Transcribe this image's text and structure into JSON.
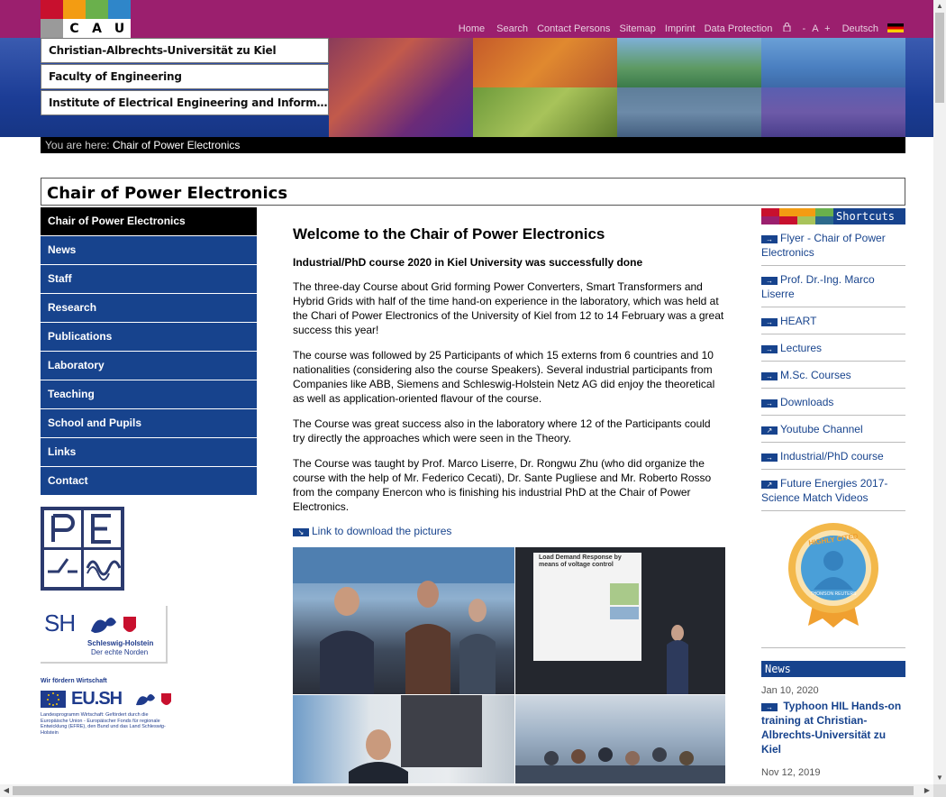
{
  "logo": {
    "letters": [
      "C",
      "A",
      "U"
    ],
    "colors": [
      "#c8102e",
      "#f39c12",
      "#6ab04c",
      "#1f8f8f",
      "#2d3a8c",
      "#888888"
    ]
  },
  "topnav": {
    "items": [
      "Home",
      "Search",
      "Contact Persons",
      "Sitemap",
      "Imprint",
      "Data Protection"
    ],
    "font_minus": "-",
    "font_a": "A",
    "font_plus": "+",
    "language": "Deutsch"
  },
  "header_tabs": [
    "Christian-Albrechts-Universität zu Kiel",
    "Faculty of Engineering",
    "Institute of Electrical Engineering and Information..."
  ],
  "breadcrumb": {
    "prefix": "You are here:",
    "current": "Chair of Power Electronics"
  },
  "page_title": "Chair of Power Electronics",
  "left_nav": [
    "Chair of Power Electronics",
    "News",
    "Staff",
    "Research",
    "Publications",
    "Laboratory",
    "Teaching",
    "School and Pupils",
    "Links",
    "Contact"
  ],
  "partner_logos": {
    "pe": "PE",
    "sh_main": "SH",
    "sh_sub1": "Schleswig-Holstein",
    "sh_sub2": "Der echte Norden",
    "eu_top": "Wir fördern Wirtschaft",
    "eu_main": "EU.SH",
    "eu_small": "Landesprogramm Wirtschaft: Gefördert durch die Europäische Union - Europäischer Fonds für regionale Entwicklung (EFRE), den Bund und das Land Schleswig-Holstein"
  },
  "main": {
    "heading": "Welcome to the Chair of Power Electronics",
    "subheading": "Industrial/PhD course 2020 in Kiel University was successfully done",
    "paragraphs": [
      "The three-day Course about Grid forming Power Converters, Smart Transformers and Hybrid Grids with half of the time hand-on experience in the laboratory, which was held at the Chari of Power Electronics of the University of Kiel from 12 to 14 February was a great success this year!",
      "The course was followed by 25 Participants of which 15 externs from 6 countries and 10 nationalities (considering also the course Speakers). Several industrial participants from Companies like ABB, Siemens and Schleswig-Holstein Netz AG did enjoy the theoretical as well as application-oriented flavour of the course.",
      "The Course was great success also in the laboratory where 12 of the Participants could try directly the approaches which were seen in the Theory.",
      "The Course was taught by Prof. Marco Liserre, Dr. Rongwu Zhu (who did organize the course with the help of Mr. Federico Cecati), Dr. Sante Pugliese and Mr. Roberto Rosso from the company Enercon who is finishing his industrial PhD at the Chair of Power Electronics."
    ],
    "download_link": "Link to download the pictures",
    "slide_title": "Load Demand Response by means of voltage control"
  },
  "shortcuts": {
    "heading": "Shortcuts",
    "items": [
      "Flyer - Chair of Power Electronics",
      "Prof. Dr.-Ing. Marco Liserre",
      "HEART",
      "Lectures",
      "M.Sc. Courses",
      "Downloads",
      "Youtube Channel",
      "Industrial/PhD course",
      "Future Energies 2017-Science Match Videos"
    ]
  },
  "badge": {
    "line1": "HIGHLY CITED",
    "line2": "THOMSON REUTERS"
  },
  "news": {
    "heading": "News",
    "items": [
      {
        "date": "Jan 10, 2020",
        "title": "Typhoon HIL Hands-on training at Christian-Albrechts-Universität zu Kiel"
      },
      {
        "date": "Nov 12, 2019",
        "title": ""
      }
    ]
  },
  "colors": {
    "brand_purple": "#9b1f6e",
    "brand_blue": "#17438d",
    "black": "#000000"
  }
}
